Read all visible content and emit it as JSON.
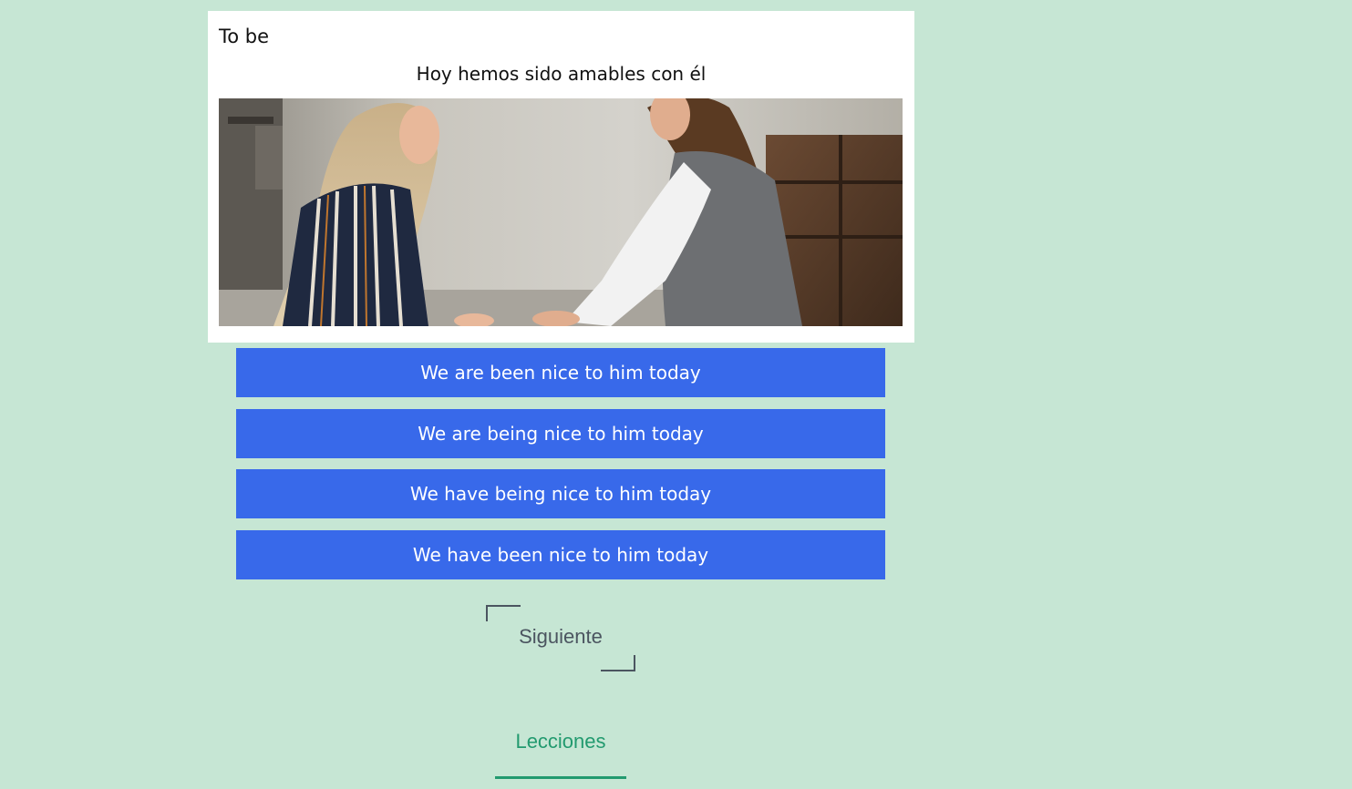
{
  "lesson": {
    "topic": "To be",
    "prompt": "Hoy hemos sido amables con él",
    "image_description_icon": "photo-two-women-talking"
  },
  "options": [
    {
      "label": "We are been nice to him today"
    },
    {
      "label": "We are being nice to him today"
    },
    {
      "label": "We have being nice to him today"
    },
    {
      "label": "We have been nice to him today"
    }
  ],
  "navigation": {
    "next_label": "Siguiente",
    "lessons_label": "Lecciones"
  },
  "colors": {
    "background": "#c6e6d4",
    "option_button": "#3869ea",
    "lessons_accent": "#229a6f",
    "next_text": "#4b5560"
  }
}
